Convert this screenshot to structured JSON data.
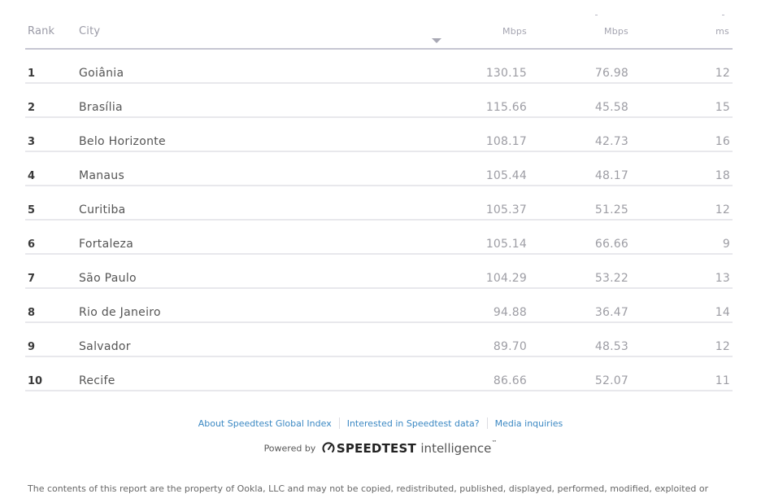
{
  "table": {
    "headers": {
      "rank": "Rank",
      "city": "City",
      "download_unit": "Mbps",
      "upload_unit": "Mbps",
      "latency_unit": "ms"
    },
    "sort": {
      "column": "download",
      "direction": "descending",
      "icon": "sort-down-icon"
    },
    "rows": [
      {
        "rank": "1",
        "city": "Goiânia",
        "download": "130.15",
        "upload": "76.98",
        "latency": "12"
      },
      {
        "rank": "2",
        "city": "Brasília",
        "download": "115.66",
        "upload": "45.58",
        "latency": "15"
      },
      {
        "rank": "3",
        "city": "Belo Horizonte",
        "download": "108.17",
        "upload": "42.73",
        "latency": "16"
      },
      {
        "rank": "4",
        "city": "Manaus",
        "download": "105.44",
        "upload": "48.17",
        "latency": "18"
      },
      {
        "rank": "5",
        "city": "Curitiba",
        "download": "105.37",
        "upload": "51.25",
        "latency": "12"
      },
      {
        "rank": "6",
        "city": "Fortaleza",
        "download": "105.14",
        "upload": "66.66",
        "latency": "9"
      },
      {
        "rank": "7",
        "city": "São Paulo",
        "download": "104.29",
        "upload": "53.22",
        "latency": "13"
      },
      {
        "rank": "8",
        "city": "Rio de Janeiro",
        "download": "94.88",
        "upload": "36.47",
        "latency": "14"
      },
      {
        "rank": "9",
        "city": "Salvador",
        "download": "89.70",
        "upload": "48.53",
        "latency": "12"
      },
      {
        "rank": "10",
        "city": "Recife",
        "download": "86.66",
        "upload": "52.07",
        "latency": "11"
      }
    ]
  },
  "footer": {
    "links": [
      "About Speedtest Global Index",
      "Interested in Speedtest data?",
      "Media inquiries"
    ],
    "powered_by": "Powered by",
    "brand": "SPEEDTEST",
    "brand_suffix": "intelligence",
    "trademark": "™",
    "disclaimer": "The contents of this report are the property of Ookla, LLC and may not be copied, redistributed, published, displayed, performed, modified, exploited or"
  },
  "colors": {
    "link": "#3b88c3",
    "header_rule": "#c6c6d2",
    "row_rule": "#e8e8ec"
  }
}
